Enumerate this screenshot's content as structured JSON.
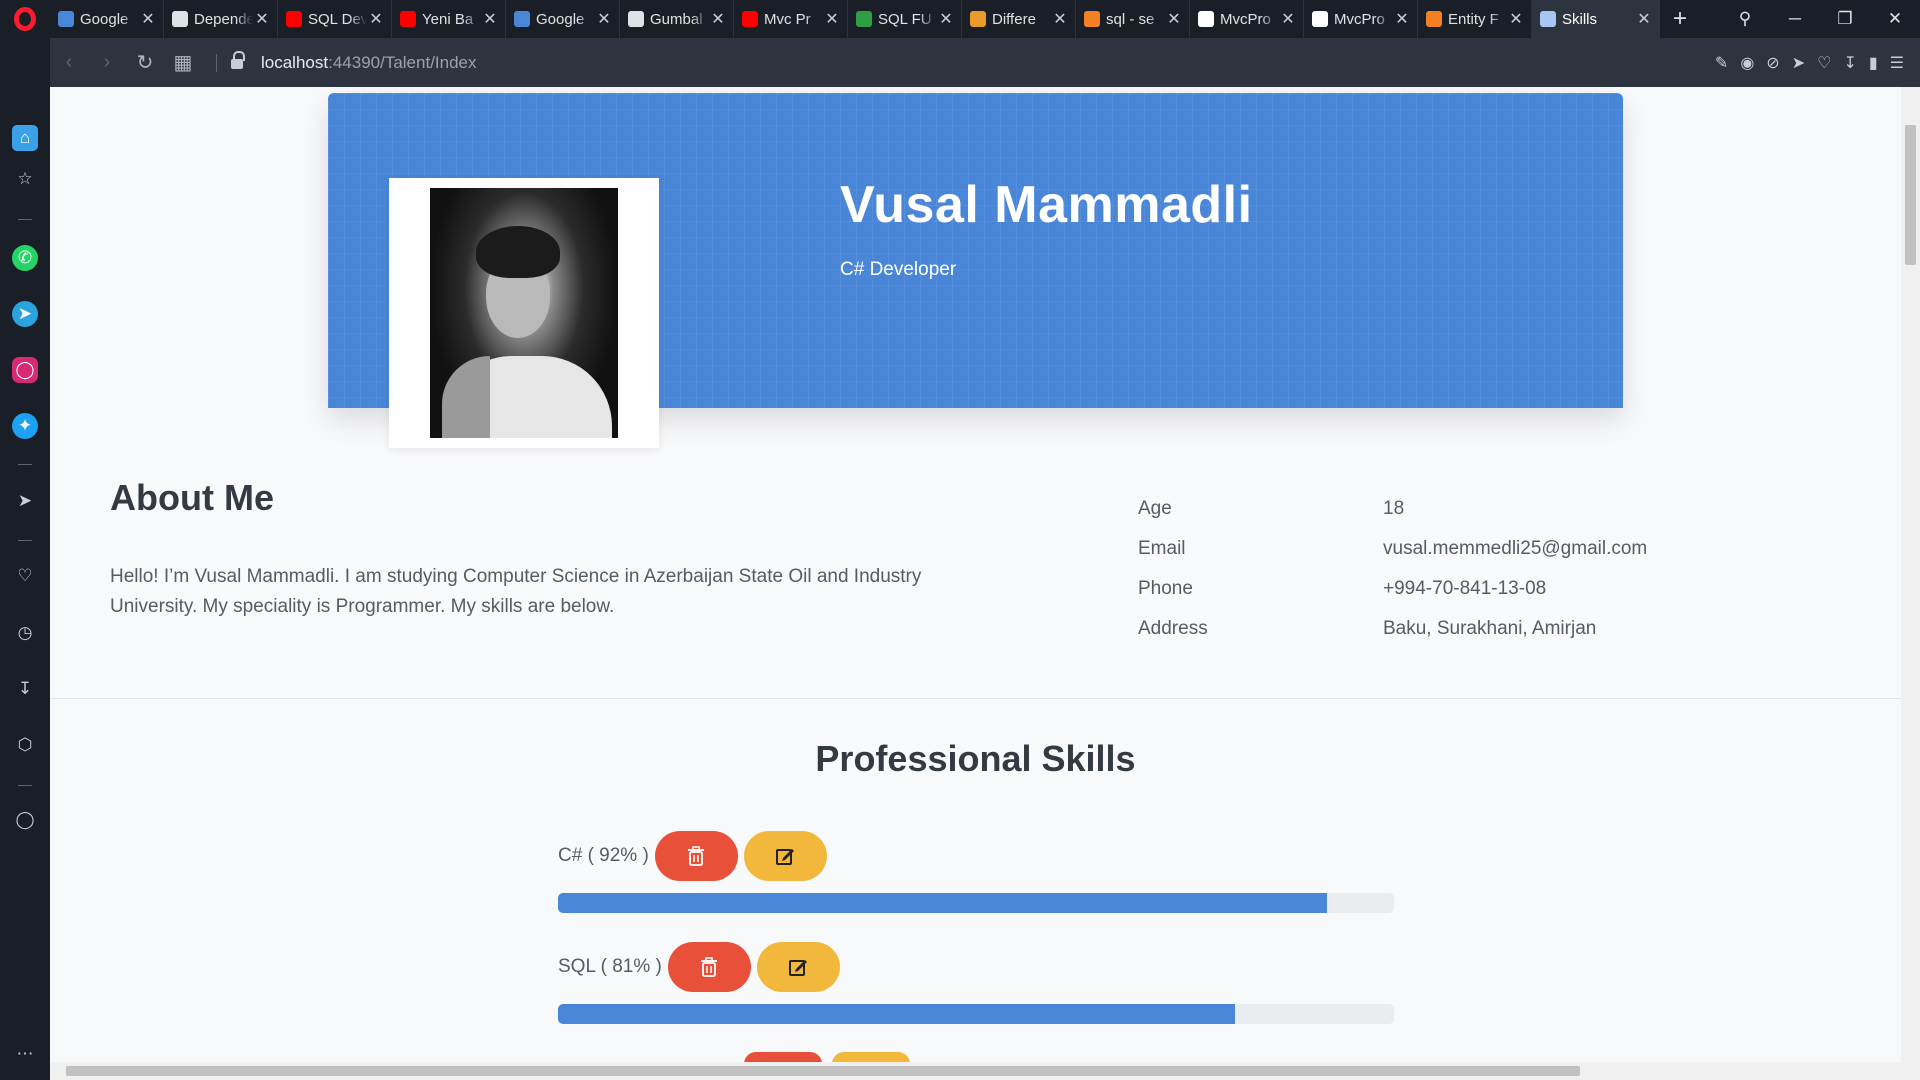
{
  "browser": {
    "tabs": [
      {
        "title": "Google",
        "color": "#4a86d8"
      },
      {
        "title": "Dependency",
        "color": "#dfe3e8"
      },
      {
        "title": "SQL Dev",
        "color": "#ff0000"
      },
      {
        "title": "Yeni Ba",
        "color": "#ff0000"
      },
      {
        "title": "Google",
        "color": "#4a86d8"
      },
      {
        "title": "Gumbal",
        "color": "#dfe3e8"
      },
      {
        "title": "Mvc Pr",
        "color": "#ff0000"
      },
      {
        "title": "SQL FU",
        "color": "#2e9e44"
      },
      {
        "title": "Differe",
        "color": "#e89b2a"
      },
      {
        "title": "sql - se",
        "color": "#f48024"
      },
      {
        "title": "MvcPro",
        "color": "#ffffff"
      },
      {
        "title": "MvcPro",
        "color": "#ffffff"
      },
      {
        "title": "Entity F",
        "color": "#f48024"
      },
      {
        "title": "Skills",
        "color": "#a7c7f2",
        "active": true
      }
    ],
    "url_host": "localhost",
    "url_path": ":44390/Talent/Index"
  },
  "profile": {
    "name": "Vusal Mammadli",
    "role": "C# Developer"
  },
  "about": {
    "title": "About Me",
    "text": "Hello! I’m Vusal Mammadli. I am studying Computer Science in Azerbaijan State Oil and Industry University. My speciality is Programmer. My skills are below.",
    "info": [
      {
        "label": "Age",
        "value": "18"
      },
      {
        "label": "Email",
        "value": "vusal.memmedli25@gmail.com"
      },
      {
        "label": "Phone",
        "value": "+994-70-841-13-08"
      },
      {
        "label": "Address",
        "value": "Baku, Surakhani, Amirjan"
      }
    ]
  },
  "skills": {
    "title": "Professional Skills",
    "items": [
      {
        "name": "C#",
        "label": "C# ( 92% )",
        "percent": 92
      },
      {
        "name": "SQL",
        "label": "SQL ( 81% )",
        "percent": 81
      }
    ]
  },
  "colors": {
    "accent": "#4a86d8",
    "delete": "#e8503a",
    "edit": "#f1b83b"
  }
}
